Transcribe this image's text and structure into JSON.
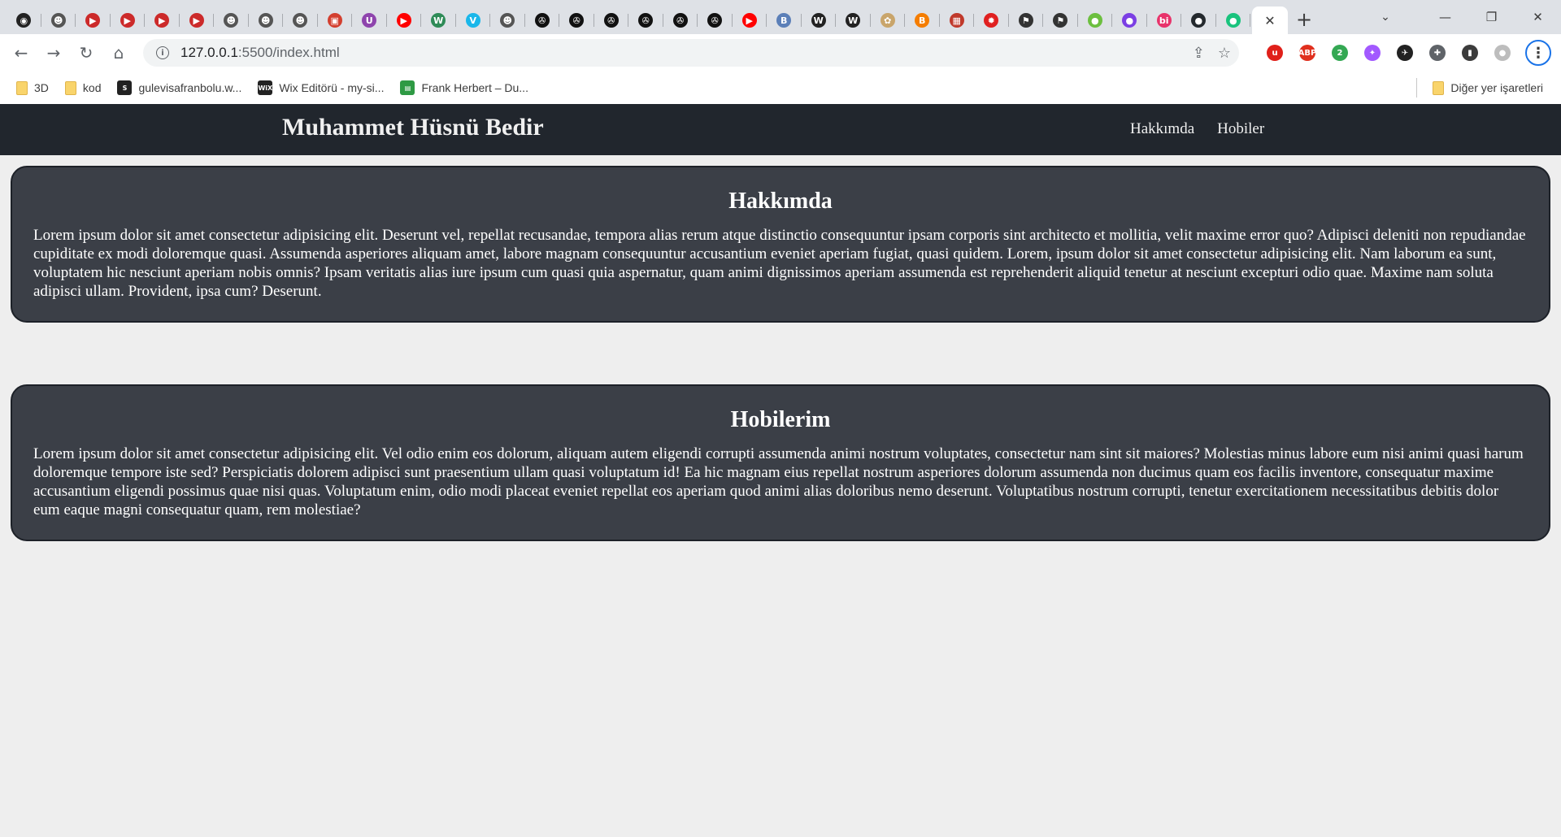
{
  "browser": {
    "pinned_tabs": [
      {
        "icon": "tiktok-like-icon",
        "color": "#222222",
        "glyph": "◉"
      },
      {
        "icon": "github-cat-icon",
        "color": "#555555",
        "glyph": "☻"
      },
      {
        "icon": "youtube-play-icon",
        "color": "#cc2a2a",
        "glyph": "▶"
      },
      {
        "icon": "youtube-play-icon",
        "color": "#cc2a2a",
        "glyph": "▶"
      },
      {
        "icon": "youtube-play-icon",
        "color": "#cc2a2a",
        "glyph": "▶"
      },
      {
        "icon": "youtube-play-icon",
        "color": "#cc2a2a",
        "glyph": "▶"
      },
      {
        "icon": "github-cat-icon",
        "color": "#555555",
        "glyph": "☻"
      },
      {
        "icon": "github-cat-icon",
        "color": "#555555",
        "glyph": "☻"
      },
      {
        "icon": "github-cat-icon",
        "color": "#555555",
        "glyph": "☻"
      },
      {
        "icon": "tv-icon",
        "color": "#d33f2f",
        "glyph": "▣"
      },
      {
        "icon": "purple-u-icon",
        "color": "#8e44ad",
        "glyph": "U"
      },
      {
        "icon": "youtube-icon",
        "color": "#ff0000",
        "glyph": "▶"
      },
      {
        "icon": "w-logo-icon",
        "color": "#2e8b57",
        "glyph": "W"
      },
      {
        "icon": "vimeo-icon",
        "color": "#1ab7ea",
        "glyph": "V"
      },
      {
        "icon": "github-cat-icon",
        "color": "#555555",
        "glyph": "☻"
      },
      {
        "icon": "film-reel-icon",
        "color": "#111111",
        "glyph": "✇"
      },
      {
        "icon": "film-reel-icon",
        "color": "#111111",
        "glyph": "✇"
      },
      {
        "icon": "film-reel-icon",
        "color": "#111111",
        "glyph": "✇"
      },
      {
        "icon": "film-reel-icon",
        "color": "#111111",
        "glyph": "✇"
      },
      {
        "icon": "film-reel-icon",
        "color": "#111111",
        "glyph": "✇"
      },
      {
        "icon": "film-reel-icon",
        "color": "#111111",
        "glyph": "✇"
      },
      {
        "icon": "youtube-icon",
        "color": "#ff0000",
        "glyph": "▶"
      },
      {
        "icon": "btk-logo-icon",
        "color": "#5b7fb8",
        "glyph": "B"
      },
      {
        "icon": "wix-logo-icon",
        "color": "#222222",
        "glyph": "W"
      },
      {
        "icon": "wix-logo-icon",
        "color": "#222222",
        "glyph": "W"
      },
      {
        "icon": "squirrel-icon",
        "color": "#c9a56b",
        "glyph": "✿"
      },
      {
        "icon": "blogger-icon",
        "color": "#f57d00",
        "glyph": "B"
      },
      {
        "icon": "calendar-icon",
        "color": "#c0392b",
        "glyph": "▦"
      },
      {
        "icon": "gear-red-icon",
        "color": "#e02020",
        "glyph": "✹"
      },
      {
        "icon": "flag-icon",
        "color": "#333333",
        "glyph": "⚑"
      },
      {
        "icon": "flag-icon",
        "color": "#333333",
        "glyph": "⚑"
      },
      {
        "icon": "drop-icon",
        "color": "#6cbf3f",
        "glyph": "●"
      },
      {
        "icon": "planet-icon",
        "color": "#7b3fe4",
        "glyph": "●"
      },
      {
        "icon": "bi-logo-icon",
        "color": "#e8336b",
        "glyph": "bi"
      },
      {
        "icon": "github-icon",
        "color": "#24292e",
        "glyph": "●"
      },
      {
        "icon": "chatgpt-icon",
        "color": "#19c37d",
        "glyph": "●"
      }
    ],
    "active_tab_close": "✕",
    "new_tab": "+",
    "tab_search": "⌄",
    "window_controls": {
      "minimize": "—",
      "maximize": "❐",
      "close": "✕"
    },
    "toolbar": {
      "back": "←",
      "forward": "→",
      "reload": "↻",
      "home": "⌂"
    },
    "address": {
      "host": "127.0.0.1",
      "path": ":5500/index.html",
      "info": "i"
    },
    "omnibox_actions": {
      "share": "⇪",
      "star": "☆"
    },
    "extensions": [
      {
        "icon": "ublock-icon",
        "color": "#e0201a",
        "glyph": "u"
      },
      {
        "icon": "adblock-plus-icon",
        "color": "#e0301e",
        "glyph": "ABP"
      },
      {
        "icon": "extension-badge-icon",
        "color": "#34a853",
        "glyph": "2"
      },
      {
        "icon": "purple-feather-icon",
        "color": "#a259ff",
        "glyph": "✦"
      },
      {
        "icon": "bird-icon",
        "color": "#222222",
        "glyph": "✈"
      },
      {
        "icon": "puzzle-icon",
        "color": "#5f6368",
        "glyph": "✚"
      },
      {
        "icon": "side-panel-icon",
        "color": "#3c3c3c",
        "glyph": "▮"
      },
      {
        "icon": "profile-avatar-icon",
        "color": "#bdbdbd",
        "glyph": "●"
      }
    ],
    "menu": "⋮",
    "bookmarks": [
      {
        "label": "3D",
        "type": "folder"
      },
      {
        "label": "kod",
        "type": "folder"
      },
      {
        "label": "gulevisafranbolu.w...",
        "type": "site",
        "icon": "s-logo-icon",
        "color": "#222222",
        "glyph": "S"
      },
      {
        "label": "Wix Editörü - my-si...",
        "type": "site",
        "icon": "wix-logo-icon",
        "color": "#222222",
        "glyph": "WiX"
      },
      {
        "label": "Frank Herbert – Du...",
        "type": "site",
        "icon": "book-icon",
        "color": "#2e9a44",
        "glyph": "▤"
      }
    ],
    "other_bookmarks": "Diğer yer işaretleri"
  },
  "page": {
    "site_title": "Muhammet Hüsnü Bedir",
    "nav": [
      {
        "label": "Hakkımda"
      },
      {
        "label": "Hobiler"
      }
    ],
    "sections": [
      {
        "heading": "Hakkımda",
        "body": "Lorem ipsum dolor sit amet consectetur adipisicing elit. Deserunt vel, repellat recusandae, tempora alias rerum atque distinctio consequuntur ipsam corporis sint architecto et mollitia, velit maxime error quo? Adipisci deleniti non repudiandae cupiditate ex modi doloremque quasi. Assumenda asperiores aliquam amet, labore magnam consequuntur accusantium eveniet aperiam fugiat, quasi quidem. Lorem, ipsum dolor sit amet consectetur adipisicing elit. Nam laborum ea sunt, voluptatem hic nesciunt aperiam nobis omnis? Ipsam veritatis alias iure ipsum cum quasi quia aspernatur, quam animi dignissimos aperiam assumenda est reprehenderit aliquid tenetur at nesciunt excepturi odio quae. Maxime nam soluta adipisci ullam. Provident, ipsa cum? Deserunt."
      },
      {
        "heading": "Hobilerim",
        "body": "Lorem ipsum dolor sit amet consectetur adipisicing elit. Vel odio enim eos dolorum, aliquam autem eligendi corrupti assumenda animi nostrum voluptates, consectetur nam sint sit maiores? Molestias minus labore eum nisi animi quasi harum doloremque tempore iste sed? Perspiciatis dolorem adipisci sunt praesentium ullam quasi voluptatum id! Ea hic magnam eius repellat nostrum asperiores dolorum assumenda non ducimus quam eos facilis inventore, consequatur maxime accusantium eligendi possimus quae nisi quas. Voluptatum enim, odio modi placeat eveniet repellat eos aperiam quod animi alias doloribus nemo deserunt. Voluptatibus nostrum corrupti, tenetur exercitationem necessitatibus debitis dolor eum eaque magni consequatur quam, rem molestiae?"
      }
    ],
    "colors": {
      "header_bg": "#21262d",
      "card_bg": "#3b3f47",
      "page_bg": "#eeeeee",
      "text": "#ffffff"
    }
  }
}
